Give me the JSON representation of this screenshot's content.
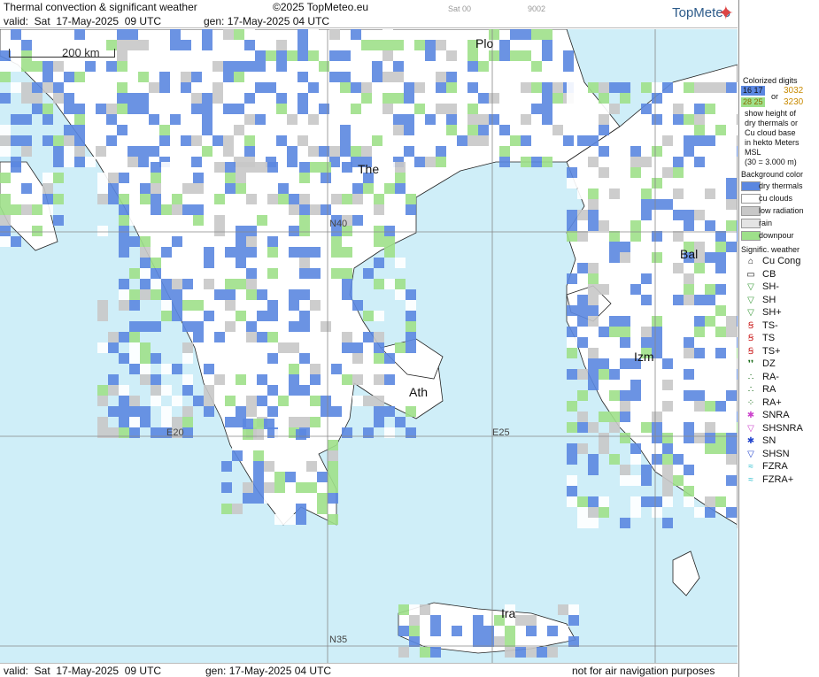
{
  "header": {
    "title": "Thermal convection & significant weather",
    "copyright": "©2025 TopMeteo.eu",
    "sat_faint": "Sat 00",
    "code_faint": "9002",
    "valid": "valid:  Sat  17-May-2025  09 UTC",
    "gen": "gen: 17-May-2025 04 UTC",
    "logo": "TopMeteo"
  },
  "footer": {
    "valid": "valid:  Sat  17-May-2025  09 UTC",
    "gen": "gen: 17-May-2025 04 UTC",
    "note": "not for air navigation purposes"
  },
  "map": {
    "scale_label": "200 km",
    "cities": [
      "Plo",
      "The",
      "Bal",
      "Izm",
      "Ath",
      "Ira"
    ],
    "grid_labels": [
      "N40",
      "E20",
      "E25",
      "N35"
    ]
  },
  "legend": {
    "colorized_title": "Colorized digits",
    "sample_a": "16 17",
    "sample_b": "28 25",
    "or": "or",
    "sample_c": "3032",
    "sample_d": "3230",
    "explain": [
      "show height of",
      "dry thermals or",
      "Cu cloud base",
      "in hekto Meters",
      "MSL",
      "(30 = 3.000 m)"
    ],
    "bg_title": "Background color",
    "bg_items": [
      {
        "label": "dry thermals",
        "color": "#5b87e0"
      },
      {
        "label": "cu clouds",
        "color": "#ffffff"
      },
      {
        "label": "low radiation",
        "color": "#c8c8c8"
      },
      {
        "label": "rain",
        "color": "#e4e4e4"
      },
      {
        "label": "downpour",
        "color": "#9ee08a"
      }
    ],
    "sig_title": "Signific. weather",
    "sig_items": [
      {
        "label": "Cu Cong",
        "icon": "cu-cong-icon",
        "glyph": "⌂",
        "color": "#111"
      },
      {
        "label": "CB",
        "icon": "cb-icon",
        "glyph": "▭",
        "color": "#111"
      },
      {
        "label": "SH-",
        "icon": "shower-light-icon",
        "glyph": "▽",
        "color": "#3a9a3a"
      },
      {
        "label": "SH",
        "icon": "shower-icon",
        "glyph": "▽",
        "color": "#3a9a3a"
      },
      {
        "label": "SH+",
        "icon": "shower-heavy-icon",
        "glyph": "▽",
        "color": "#3a9a3a"
      },
      {
        "label": "TS-",
        "icon": "thunder-light-icon",
        "glyph": "Ꞩ",
        "color": "#cc2222"
      },
      {
        "label": "TS",
        "icon": "thunder-icon",
        "glyph": "Ꞩ",
        "color": "#cc2222"
      },
      {
        "label": "TS+",
        "icon": "thunder-heavy-icon",
        "glyph": "Ꞩ",
        "color": "#cc2222"
      },
      {
        "label": "DZ",
        "icon": "drizzle-icon",
        "glyph": "❜❜",
        "color": "#116611"
      },
      {
        "label": "RA-",
        "icon": "rain-light-icon",
        "glyph": "∴",
        "color": "#116611"
      },
      {
        "label": "RA",
        "icon": "rain-icon",
        "glyph": "∴",
        "color": "#116611"
      },
      {
        "label": "RA+",
        "icon": "rain-heavy-icon",
        "glyph": "⁘",
        "color": "#116611"
      },
      {
        "label": "SNRA",
        "icon": "snow-rain-icon",
        "glyph": "✱",
        "color": "#cc44cc"
      },
      {
        "label": "SHSNRA",
        "icon": "snow-rain-shower-icon",
        "glyph": "▽",
        "color": "#cc44cc"
      },
      {
        "label": "SN",
        "icon": "snow-icon",
        "glyph": "✱",
        "color": "#2244cc"
      },
      {
        "label": "SHSN",
        "icon": "snow-shower-icon",
        "glyph": "▽",
        "color": "#2244cc"
      },
      {
        "label": "FZRA",
        "icon": "freezing-rain-icon",
        "glyph": "≈",
        "color": "#22bbcc"
      },
      {
        "label": "FZRA+",
        "icon": "freezing-rain-heavy-icon",
        "glyph": "≈",
        "color": "#22bbcc"
      }
    ]
  }
}
